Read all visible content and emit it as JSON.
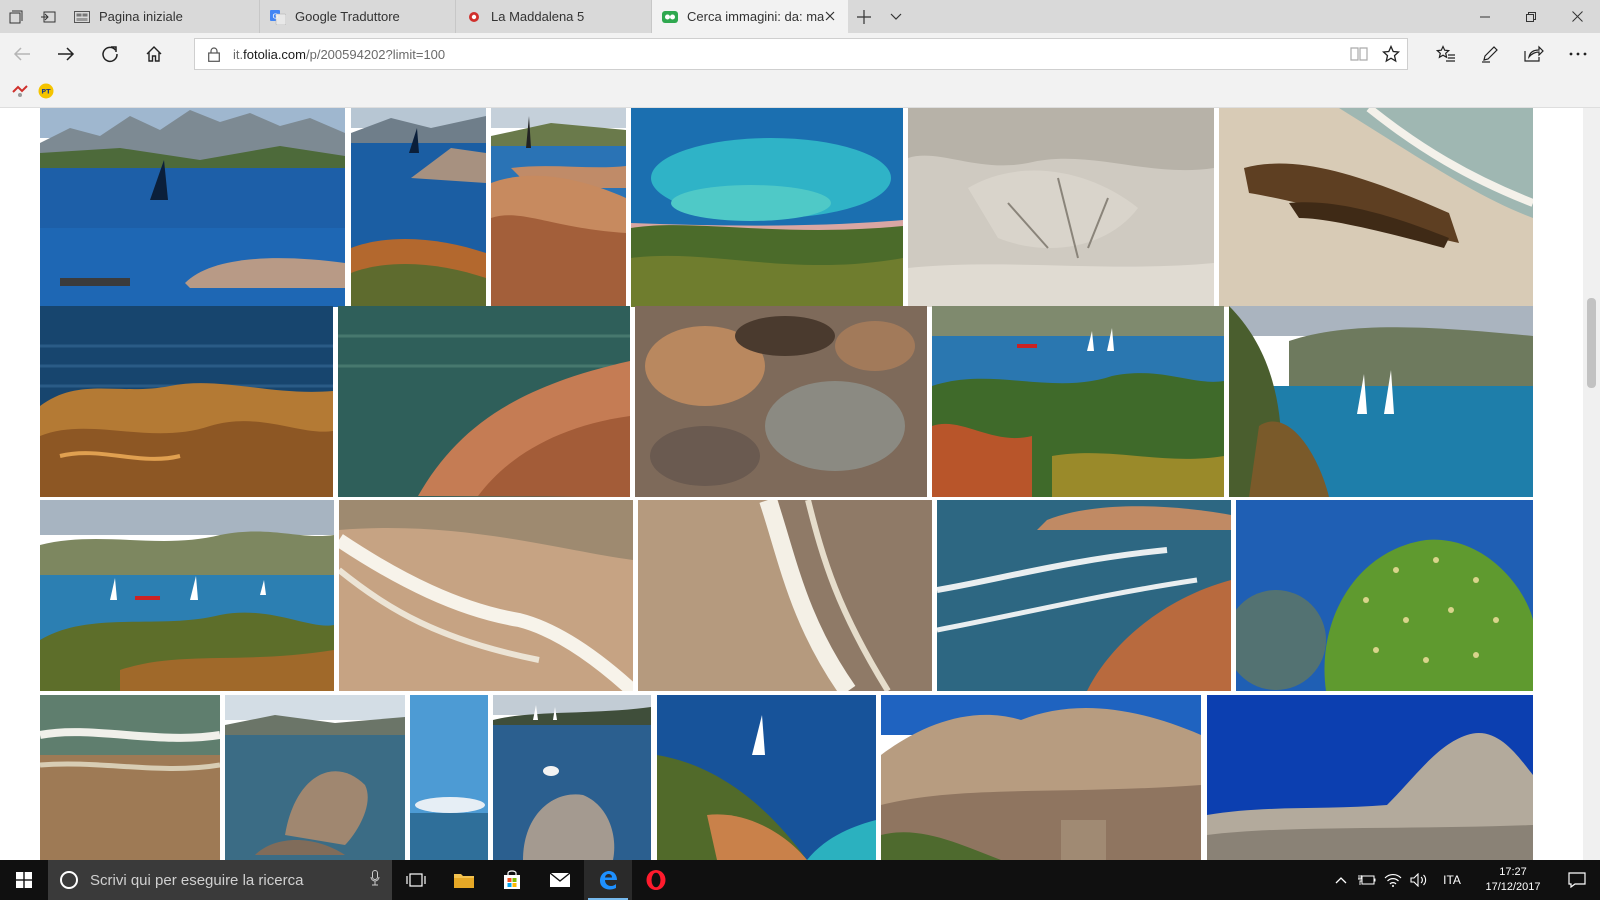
{
  "tabs": [
    {
      "label": "Pagina iniziale",
      "icon": "start-page-icon"
    },
    {
      "label": "Google Traduttore",
      "icon": "google-translate-icon"
    },
    {
      "label": "La Maddalena 5",
      "icon": "site-favicon"
    },
    {
      "label": "Cerca immagini: da: ma",
      "icon": "fotolia-favicon",
      "active": true
    }
  ],
  "address": {
    "prefix": "it.",
    "domain": "fotolia.com",
    "path": "/p/200594202?limit=100"
  },
  "favorites": [
    {
      "icon": "favorite-red-icon"
    },
    {
      "icon": "favorite-pt-icon",
      "label": "PT"
    }
  ],
  "taskbar": {
    "search_placeholder": "Scrivi qui per eseguire la ricerca",
    "language": "ITA",
    "time": "17:27",
    "date": "17/12/2017"
  }
}
